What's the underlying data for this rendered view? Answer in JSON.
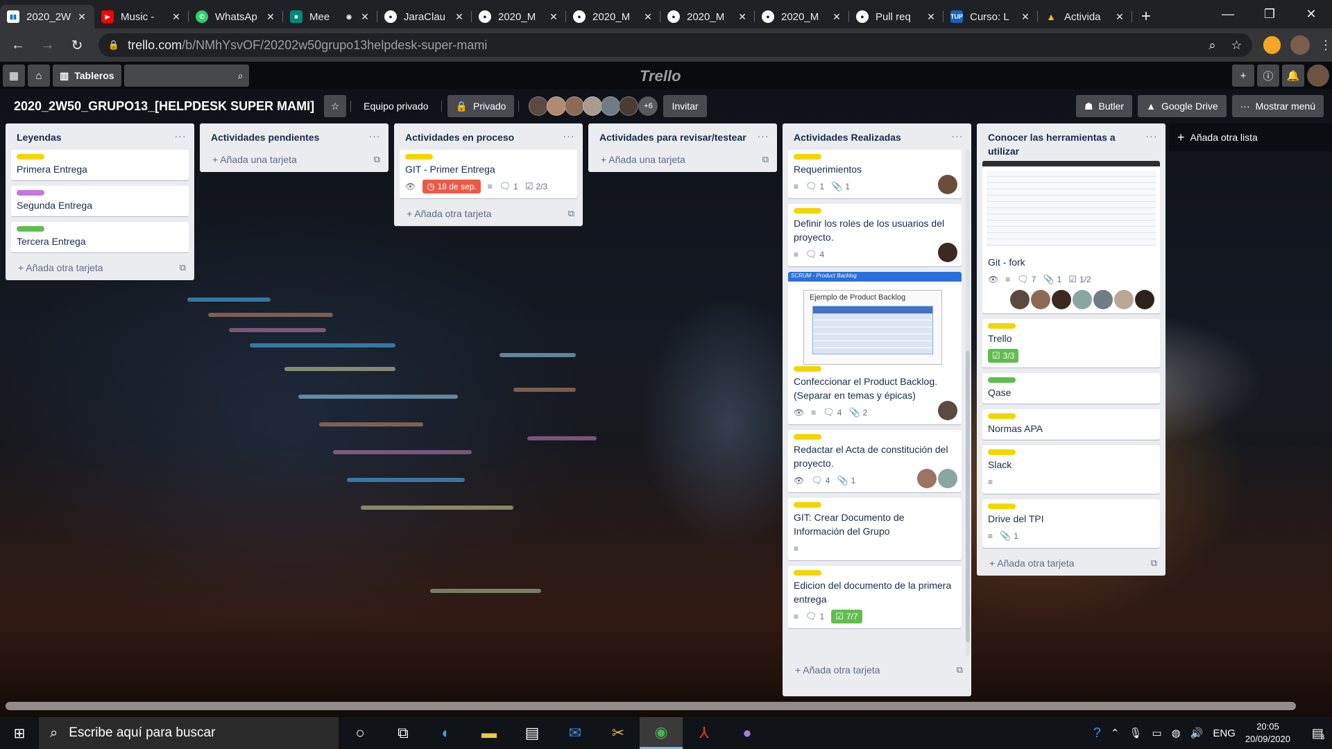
{
  "browser": {
    "tabs": [
      {
        "title": "2020_2W",
        "icon": "trello-icon",
        "color": "#ffffff",
        "active": true
      },
      {
        "title": "Music - ",
        "icon": "youtube-icon",
        "color": "#ff0000"
      },
      {
        "title": "WhatsAp",
        "icon": "whatsapp-icon",
        "color": "#25d366"
      },
      {
        "title": "Mee",
        "icon": "meet-icon",
        "color": "#00897b"
      },
      {
        "title": "JaraClau",
        "icon": "github-icon",
        "color": "#ffffff"
      },
      {
        "title": "2020_M",
        "icon": "github-icon",
        "color": "#ffffff"
      },
      {
        "title": "2020_M",
        "icon": "github-icon",
        "color": "#ffffff"
      },
      {
        "title": "2020_M",
        "icon": "github-icon",
        "color": "#ffffff"
      },
      {
        "title": "2020_M",
        "icon": "github-icon",
        "color": "#ffffff"
      },
      {
        "title": "Pull req",
        "icon": "github-icon",
        "color": "#ffffff"
      },
      {
        "title": "Curso: L",
        "icon": "tup-icon",
        "color": "#1565c0"
      },
      {
        "title": "Activida",
        "icon": "drive-icon",
        "color": "#fbbc04"
      }
    ],
    "url_host": "trello.com",
    "url_path": "/b/NMhYsvOF/20202w50grupo13helpdesk-super-mami"
  },
  "trello_header": {
    "boards_label": "Tableros",
    "logo": "Trello"
  },
  "board": {
    "title": "2020_2W50_GRUPO13_[HELPDESK SUPER MAMI]",
    "team": "Equipo privado",
    "visibility": "Privado",
    "members_more": "+6",
    "invite": "Invitar",
    "butler": "Butler",
    "google_drive": "Google Drive",
    "menu": "Mostrar menú"
  },
  "lists": [
    {
      "title": "Leyendas",
      "add": "Añada otra tarjeta",
      "cards": [
        {
          "label": "#f2d600",
          "title": "Primera Entrega"
        },
        {
          "label": "#c377e0",
          "title": "Segunda Entrega"
        },
        {
          "label": "#61bd4f",
          "title": "Tercera Entrega"
        }
      ]
    },
    {
      "title": "Actividades pendientes",
      "add": "Añada una tarjeta",
      "cards": []
    },
    {
      "title": "Actividades en proceso",
      "add": "Añada otra tarjeta",
      "cards": [
        {
          "label": "#f2d600",
          "title": "GIT - Primer Entrega",
          "due": "18 de sep.",
          "comments": "1",
          "checklist": "2/3"
        }
      ]
    },
    {
      "title": "Actividades para revisar/testear",
      "add": "Añada una tarjeta",
      "cards": []
    },
    {
      "title": "Actividades Realizadas",
      "add": "Añada otra tarjeta",
      "cards": [
        {
          "label": "#f2d600",
          "title": "Requerimientos",
          "comments": "1",
          "attachments": "1"
        },
        {
          "label": "#f2d600",
          "title": "Definir los roles de los usuarios del proyecto.",
          "comments": "4"
        },
        {
          "label": "#f2d600",
          "title": "Confeccionar el Product Backlog. (Separar en temas y épicas)",
          "comments": "4",
          "attachments": "2",
          "cover_caption": "SCRUM - Product Backlog",
          "cover_heading": "Ejemplo de Product Backlog"
        },
        {
          "label": "#f2d600",
          "title": "Redactar el Acta de constitución del proyecto.",
          "comments": "4",
          "attachments": "1"
        },
        {
          "label": "#f2d600",
          "title": "GIT: Crear Documento de Información del Grupo"
        },
        {
          "label": "#f2d600",
          "title": "Edicion del documento de la primera entrega",
          "comments": "1",
          "checklist": "7/7"
        }
      ]
    },
    {
      "title": "Conocer las herramientas a utilizar",
      "add": "Añada otra tarjeta",
      "cards": [
        {
          "title": "Git - fork",
          "comments": "7",
          "attachments": "1",
          "checklist": "1/2"
        },
        {
          "label": "#f2d600",
          "title": "Trello",
          "checklist": "3/3"
        },
        {
          "label": "#61bd4f",
          "title": "Qase"
        },
        {
          "label": "#f2d600",
          "title": "Normas APA"
        },
        {
          "label": "#f2d600",
          "title": "Slack"
        },
        {
          "label": "#f2d600",
          "title": "Drive del TPI",
          "attachments": "1"
        }
      ]
    }
  ],
  "add_list": "Añada otra lista",
  "taskbar": {
    "search_placeholder": "Escribe aquí para buscar",
    "lang": "ENG",
    "time": "20:05",
    "date": "20/09/2020",
    "notifications": "3"
  }
}
